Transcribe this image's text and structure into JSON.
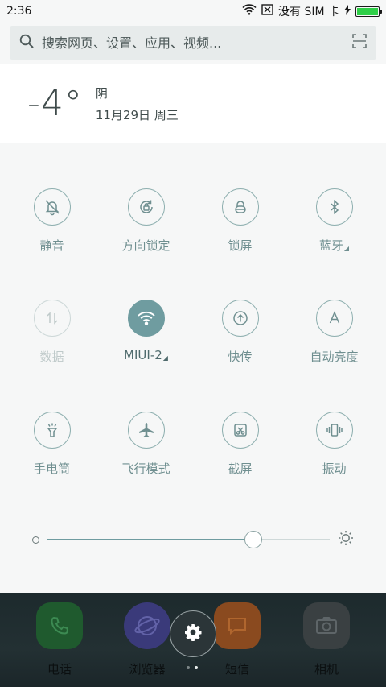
{
  "status": {
    "time": "2:36",
    "sim_text": "没有 SIM 卡"
  },
  "search": {
    "placeholder": "搜索网页、设置、应用、视频..."
  },
  "weather": {
    "temperature": "-4°",
    "condition": "阴",
    "date": "11月29日 周三"
  },
  "toggles": [
    {
      "label": "静音",
      "icon": "bell-muted-icon",
      "state": "normal"
    },
    {
      "label": "方向锁定",
      "icon": "rotation-lock-icon",
      "state": "normal"
    },
    {
      "label": "锁屏",
      "icon": "lock-icon",
      "state": "normal"
    },
    {
      "label": "蓝牙",
      "icon": "bluetooth-icon",
      "state": "normal",
      "has_more": true
    },
    {
      "label": "数据",
      "icon": "mobile-data-icon",
      "state": "disabled"
    },
    {
      "label": "MIUI-2",
      "icon": "wifi-icon",
      "state": "active",
      "has_more": true
    },
    {
      "label": "快传",
      "icon": "quick-transfer-icon",
      "state": "normal"
    },
    {
      "label": "自动亮度",
      "icon": "auto-brightness-icon",
      "state": "normal"
    },
    {
      "label": "手电筒",
      "icon": "flashlight-icon",
      "state": "normal"
    },
    {
      "label": "飞行模式",
      "icon": "airplane-icon",
      "state": "normal"
    },
    {
      "label": "截屏",
      "icon": "screenshot-icon",
      "state": "normal"
    },
    {
      "label": "振动",
      "icon": "vibrate-icon",
      "state": "normal"
    }
  ],
  "brightness": {
    "level": 0.73
  },
  "dock": {
    "apps": [
      {
        "label": "电话",
        "icon": "phone-icon",
        "color": "#1f5a2e"
      },
      {
        "label": "浏览器",
        "icon": "browser-icon",
        "color": "#3a3a7a"
      },
      {
        "label": "短信",
        "icon": "message-icon",
        "color": "#8a4a1f"
      },
      {
        "label": "相机",
        "icon": "camera-icon",
        "color": "#3a4042"
      }
    ]
  },
  "colors": {
    "accent": "#6f9ca0",
    "battery": "#2fcf48"
  }
}
